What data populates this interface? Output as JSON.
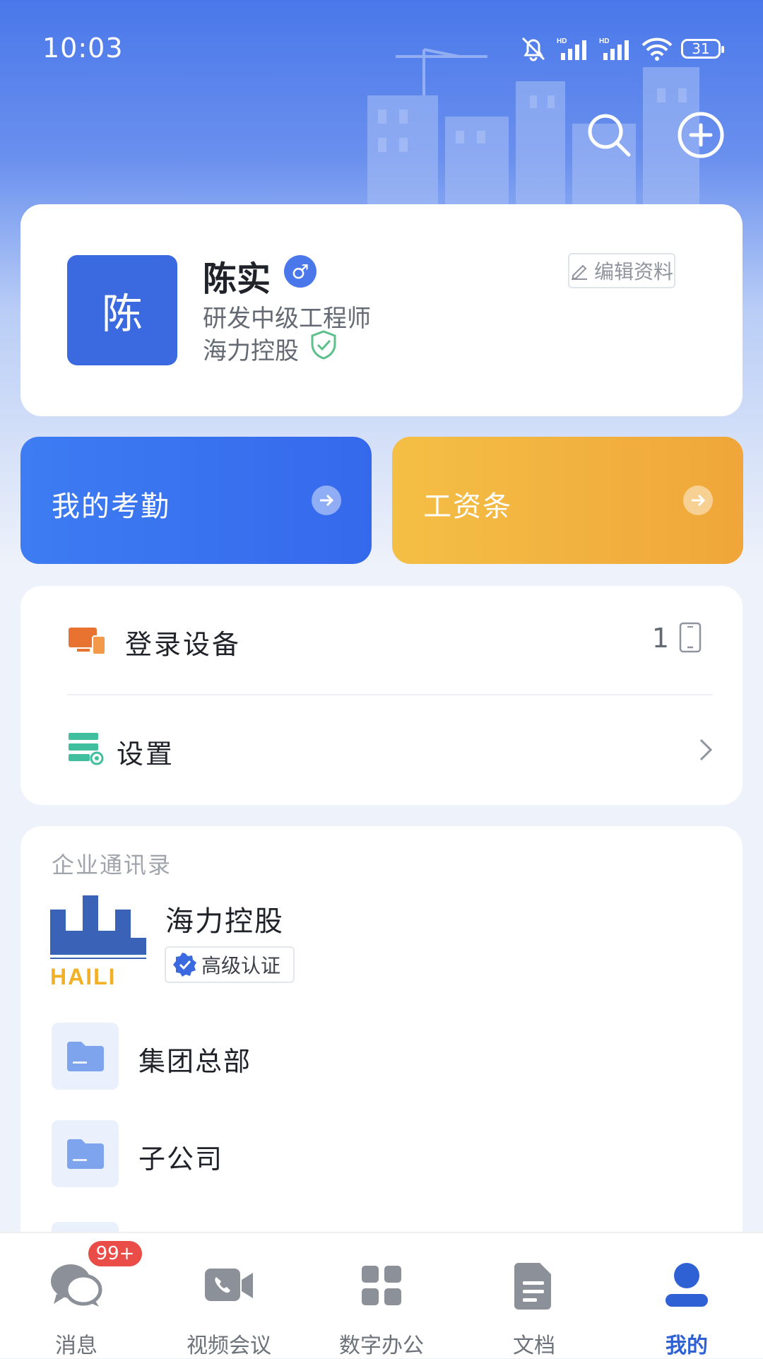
{
  "status_bar": {
    "time": "10:03",
    "battery": "31"
  },
  "profile": {
    "avatar_text": "陈",
    "name": "陈实",
    "title": "研发中级工程师",
    "company": "海力控股",
    "edit_label": "编辑资料"
  },
  "quick_tiles": [
    {
      "label": "我的考勤"
    },
    {
      "label": "工资条"
    }
  ],
  "menu": {
    "login_devices": {
      "label": "登录设备",
      "count": "1"
    },
    "settings": {
      "label": "设置"
    }
  },
  "directory": {
    "title": "企业通讯录",
    "org_name": "海力控股",
    "logo_text": "HAILI",
    "cert_label": "高级认证",
    "folders": [
      {
        "label": "集团总部"
      },
      {
        "label": "子公司"
      }
    ]
  },
  "tabbar": {
    "items": [
      {
        "label": "消息",
        "badge": "99+"
      },
      {
        "label": "视频会议"
      },
      {
        "label": "数字办公"
      },
      {
        "label": "文档"
      },
      {
        "label": "我的"
      }
    ]
  },
  "colors": {
    "primary": "#3b6ae0",
    "salary_tile": "#f0a63a",
    "badge": "#ea4d47",
    "active_tab": "#2f61d5"
  }
}
